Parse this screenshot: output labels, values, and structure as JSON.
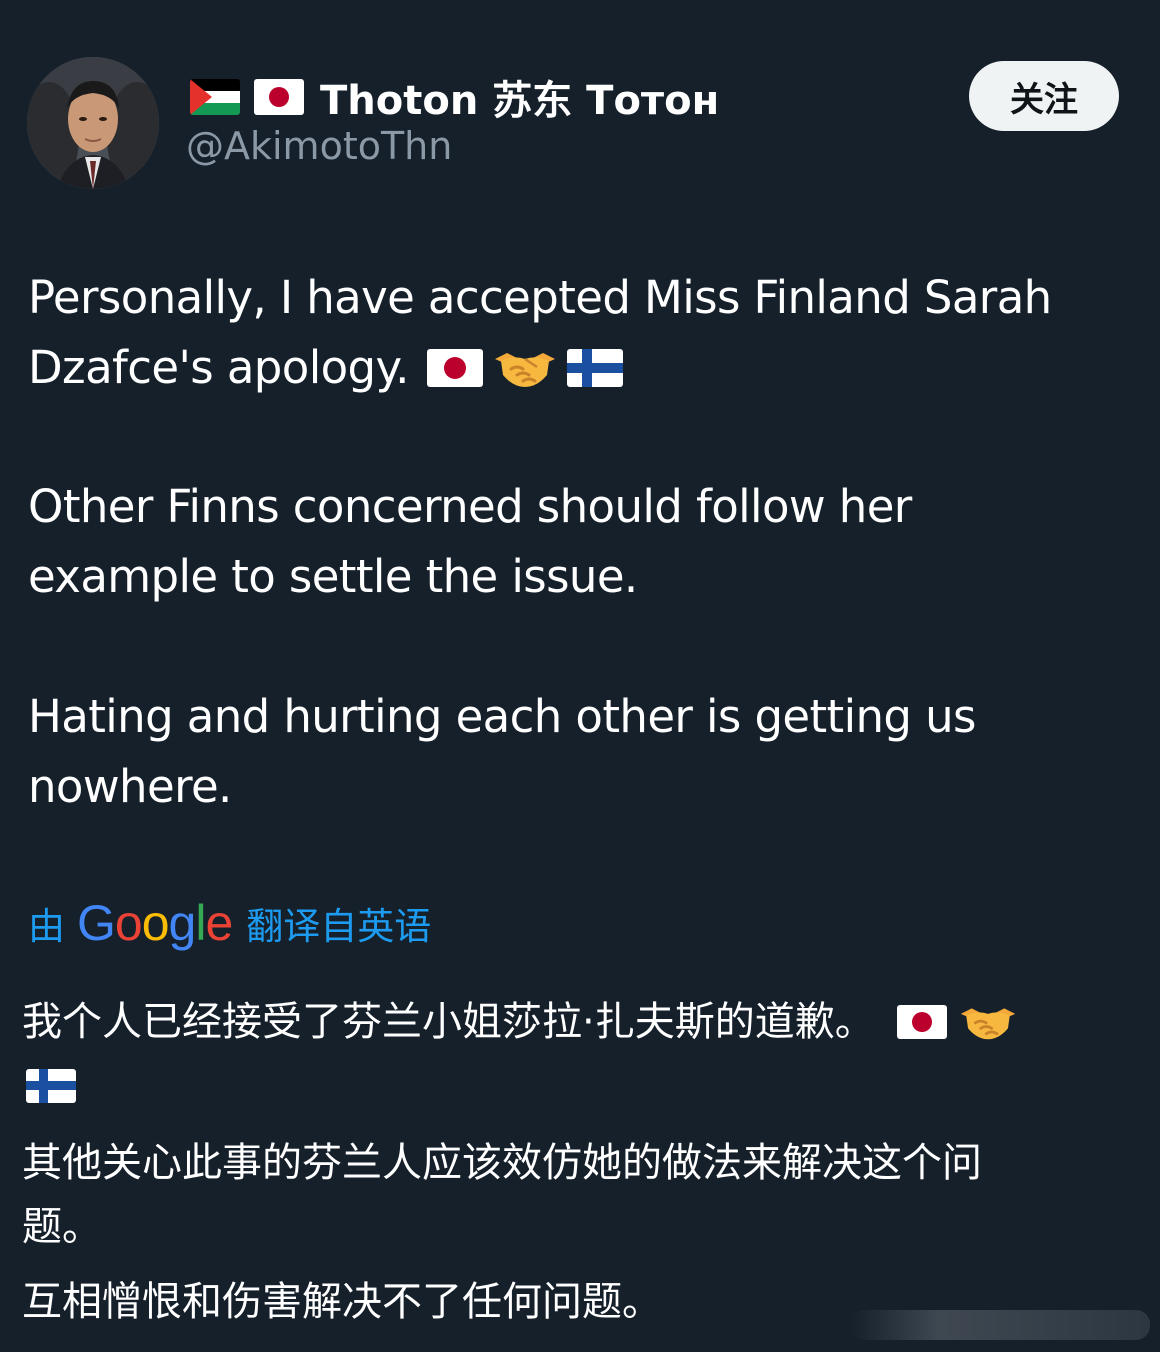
{
  "header": {
    "display_name": "Thoton 苏东 Тотон",
    "handle": "@AkimotoThn",
    "follow_label": "关注",
    "name_flags": [
      "palestine-flag",
      "japan-flag"
    ]
  },
  "tweet": {
    "p1_line1": "Personally, I have accepted Miss Finland Sarah",
    "p1_line2": "Dzafce's apology.",
    "p1_emojis": [
      "japan-flag",
      "handshake-icon",
      "finland-flag"
    ],
    "p2_line1": "Other Finns concerned should follow her",
    "p2_line2": "example to settle the issue.",
    "p3_line1": "Hating and hurting each other is getting us",
    "p3_line2": "nowhere."
  },
  "translation": {
    "prefix": "由",
    "google_letters": [
      "G",
      "o",
      "o",
      "g",
      "l",
      "e"
    ],
    "suffix": "翻译自英语",
    "zh_p1": "我个人已经接受了芬兰小姐莎拉·扎夫斯的道歉。",
    "zh_p2_line1": "其他关心此事的芬兰人应该效仿她的做法来解决这个问",
    "zh_p2_line2": "题。",
    "zh_p3": "互相憎恨和伤害解决不了任何问题。"
  },
  "colors": {
    "background": "#15202b",
    "text_primary": "#ffffff",
    "text_secondary": "#8b98a5",
    "link_blue": "#1d9bf0",
    "follow_bg": "#eff3f4"
  }
}
